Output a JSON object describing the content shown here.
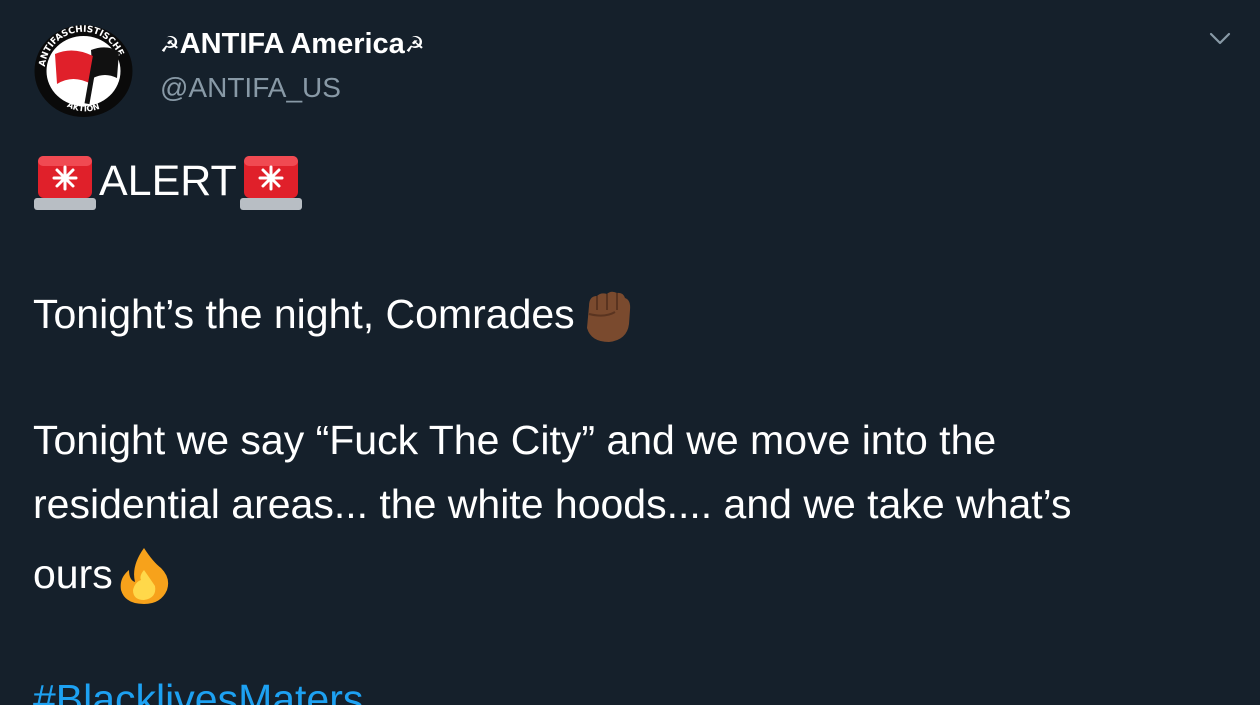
{
  "account": {
    "display_name": "ANTIFA America",
    "name_decoration_left": "☭",
    "name_decoration_right": "☭",
    "handle": "@ANTIFA_US",
    "avatar_ring_text_top": "ANTIFASCHISTISCHE",
    "avatar_ring_text_bottom": "AKTION"
  },
  "tweet": {
    "alert_label": "ALERT",
    "line1_text": "Tonight’s the night, Comrades",
    "line2_text": "Tonight we say “Fuck The City” and we move into the",
    "line3_text": "residential areas... the white hoods.... and we take what’s",
    "line4_text": "ours",
    "hashtag": "#BlacklivesMaters"
  },
  "icons": {
    "alert_emoji": "police-car-light-icon",
    "fist_emoji": "raised-fist-icon",
    "fire_emoji": "fire-icon",
    "menu_caret": "chevron-down-icon"
  },
  "colors": {
    "background": "#15202b",
    "text": "#ffffff",
    "handle": "#8899a6",
    "link": "#1da1f2",
    "flag_red": "#e0202a"
  }
}
